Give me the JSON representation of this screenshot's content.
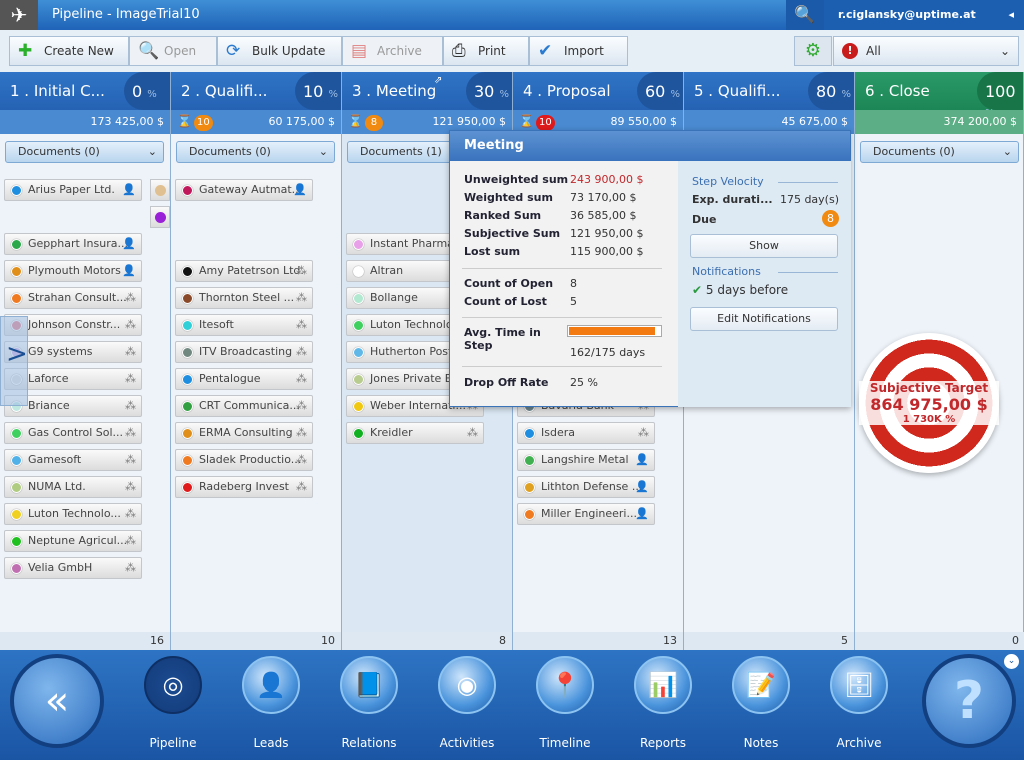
{
  "window": {
    "title": "Pipeline - ImageTrial10",
    "user": "r.ciglansky@uptime.at",
    "app_icon": "airplane-icon"
  },
  "toolbar": {
    "create_new": "Create New",
    "open": "Open",
    "bulk_update": "Bulk Update",
    "archive": "Archive",
    "print": "Print",
    "import": "Import",
    "filter": "All"
  },
  "columns": [
    {
      "name": "1 . Initial C...",
      "percent": "0",
      "sum": "173 425,00 $",
      "documents": "Documents (0)",
      "count": "16",
      "due": null,
      "cards": [
        [
          "Arius Paper Ltd.",
          "#1e8fe0",
          "person"
        ],
        [
          "Gepphart Insura...",
          "#2aa84a",
          "person"
        ],
        [
          "Plymouth Motors",
          "#e0901a",
          "person"
        ],
        [
          "Strahan Consult...",
          "#f07a20",
          "org"
        ],
        [
          "Johnson Constr...",
          "#e07a8a",
          "org"
        ],
        [
          "G9 systems",
          "#c8a8e0",
          "org"
        ],
        [
          "Laforce",
          "#dddddd",
          "org"
        ],
        [
          "Briance",
          "#bfe8e0",
          "org"
        ],
        [
          "Gas Control Sol...",
          "#40d060",
          "org"
        ],
        [
          "Gamesoft",
          "#50b0e8",
          "org"
        ],
        [
          "NUMA Ltd.",
          "#b0cc80",
          "org"
        ],
        [
          "Luton Technolo...",
          "#f0d020",
          "org"
        ],
        [
          "Neptune Agricul...",
          "#20c020",
          "org"
        ],
        [
          "Velia GmbH",
          "#c070b0",
          "org"
        ]
      ]
    },
    {
      "name": "2 . Qualifi...",
      "percent": "10",
      "sum": "60 175,00 $",
      "documents": "Documents (0)",
      "count": "10",
      "due": {
        "value": "10",
        "color": "#f08a10"
      },
      "cards": [
        [
          "Gateway Autmat...",
          "#c0185a",
          "person"
        ],
        [
          "Amy Patetrson Ltd.",
          "#111111",
          "org"
        ],
        [
          "Thornton Steel ...",
          "#8a4a2a",
          "org"
        ],
        [
          "Itesoft",
          "#30d0d8",
          "org"
        ],
        [
          "ITV Broadcasting",
          "#708880",
          "org"
        ],
        [
          "Pentalogue",
          "#1e8fe0",
          "org"
        ],
        [
          "CRT Communica...",
          "#30a040",
          "org"
        ],
        [
          "ERMA Consulting",
          "#e0901a",
          "org"
        ],
        [
          "Sladek Productio...",
          "#f07a20",
          "org"
        ],
        [
          "Radeberg Invest",
          "#e01a1a",
          "org"
        ]
      ]
    },
    {
      "name": "3 . Meeting",
      "percent": "30",
      "sum": "121 950,00 $",
      "documents": "Documents (1)",
      "count": "8",
      "due": {
        "value": "8",
        "color": "#f08a10"
      },
      "cards": [
        [
          "Instant Pharma ...",
          "#e8a0e8",
          "org"
        ],
        [
          "Altran",
          "#ffffff",
          "org"
        ],
        [
          "Bollange",
          "#b0e8d0",
          "org"
        ],
        [
          "Luton Technolo...",
          "#40d060",
          "org"
        ],
        [
          "Hutherton Post",
          "#60b8e8",
          "org"
        ],
        [
          "Jones Private Ba...",
          "#b8cc90",
          "org"
        ],
        [
          "Weber Internati...",
          "#f0c810",
          "org"
        ],
        [
          "Kreidler",
          "#10b020",
          "org"
        ]
      ]
    },
    {
      "name": "4 . Proposal",
      "percent": "60",
      "sum": "89 550,00 $",
      "documents": "",
      "count": "13",
      "due": {
        "value": "10",
        "color": "#e01a1a"
      },
      "cards": [
        [
          "Bavaria Bank",
          "#708890",
          "org"
        ],
        [
          "Isdera",
          "#1e8fe0",
          "org"
        ],
        [
          "Langshire Metal",
          "#40b050",
          "person"
        ],
        [
          "Lithton Defense ...",
          "#e0a020",
          "person"
        ],
        [
          "Miller Engineeri...",
          "#f07a20",
          "person"
        ]
      ]
    },
    {
      "name": "5 . Qualifi...",
      "percent": "80",
      "sum": "45 675,00 $",
      "documents": "",
      "count": "5",
      "due": null,
      "cards": []
    },
    {
      "name": "6 . Close",
      "percent": "100",
      "sum": "374 200,00 $",
      "documents": "Documents (0)",
      "count": "0",
      "due": null,
      "cards": []
    }
  ],
  "tooltip": {
    "title": "Meeting",
    "sums": [
      [
        "Unweighted sum",
        "243 900,00 $"
      ],
      [
        "Weighted sum",
        "73 170,00 $"
      ],
      [
        "Ranked Sum",
        "36 585,00 $"
      ],
      [
        "Subjective Sum",
        "121 950,00 $"
      ],
      [
        "Lost sum",
        "115 900,00 $"
      ]
    ],
    "counts": [
      [
        "Count of Open",
        "8"
      ],
      [
        "Count of Lost",
        "5"
      ]
    ],
    "avg_time_label": "Avg. Time in Step",
    "avg_time_value": "162/175 days",
    "avg_time_progress": 0.926,
    "drop_off_label": "Drop Off Rate",
    "drop_off_value": "25 %",
    "step_velocity": "Step Velocity",
    "exp_duration_label": "Exp. durati...",
    "exp_duration_value": "175 day(s)",
    "due_label": "Due",
    "due_value": "8",
    "show": "Show",
    "notifications": "Notifications",
    "notify_text": "5 days before",
    "edit_notifications": "Edit Notifications",
    "accent_red": "#c0282c"
  },
  "target": {
    "label": "Subjective Target",
    "value": "864 975,00 $",
    "percent": "1 730K %"
  },
  "nav": [
    "Pipeline",
    "Leads",
    "Relations",
    "Activities",
    "Timeline",
    "Reports",
    "Notes",
    "Archive"
  ],
  "colors": {
    "header_blue": "#2f74c6",
    "close_green": "#2a9a68"
  }
}
